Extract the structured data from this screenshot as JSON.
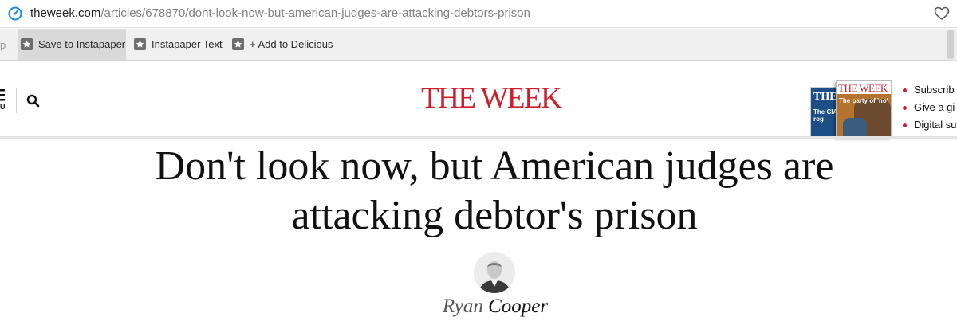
{
  "browser": {
    "url_host": "theweek.com",
    "url_path": "/articles/678870/dont-look-now-but-american-judges-are-attacking-debtors-prison"
  },
  "bookmarks": {
    "truncated_left": "p",
    "items": [
      {
        "label": "Save to Instapaper",
        "icon": "bookmark-star-icon",
        "active": true
      },
      {
        "label": "Instapaper Text",
        "icon": "bookmark-star-icon",
        "active": false
      },
      {
        "label": "+ Add to Delicious",
        "icon": "bookmark-star-icon",
        "active": false
      }
    ]
  },
  "site": {
    "logo": "THE WEEK",
    "menu_label": "U",
    "logo_color": "#cc1f2b",
    "covers": {
      "back_title": "THE",
      "back_subtitle": "The CIA goes rog",
      "front_title": "THE WEEK",
      "front_subtitle": "The party of 'no'"
    },
    "subscribe_links": [
      "Subscrib",
      "Give a gi",
      "Digital su"
    ]
  },
  "article": {
    "headline_line1": "Don't look now, but American judges are",
    "headline_line2": "attacking debtor's prison",
    "author_first": "Ryan",
    "author_last": "Cooper"
  }
}
